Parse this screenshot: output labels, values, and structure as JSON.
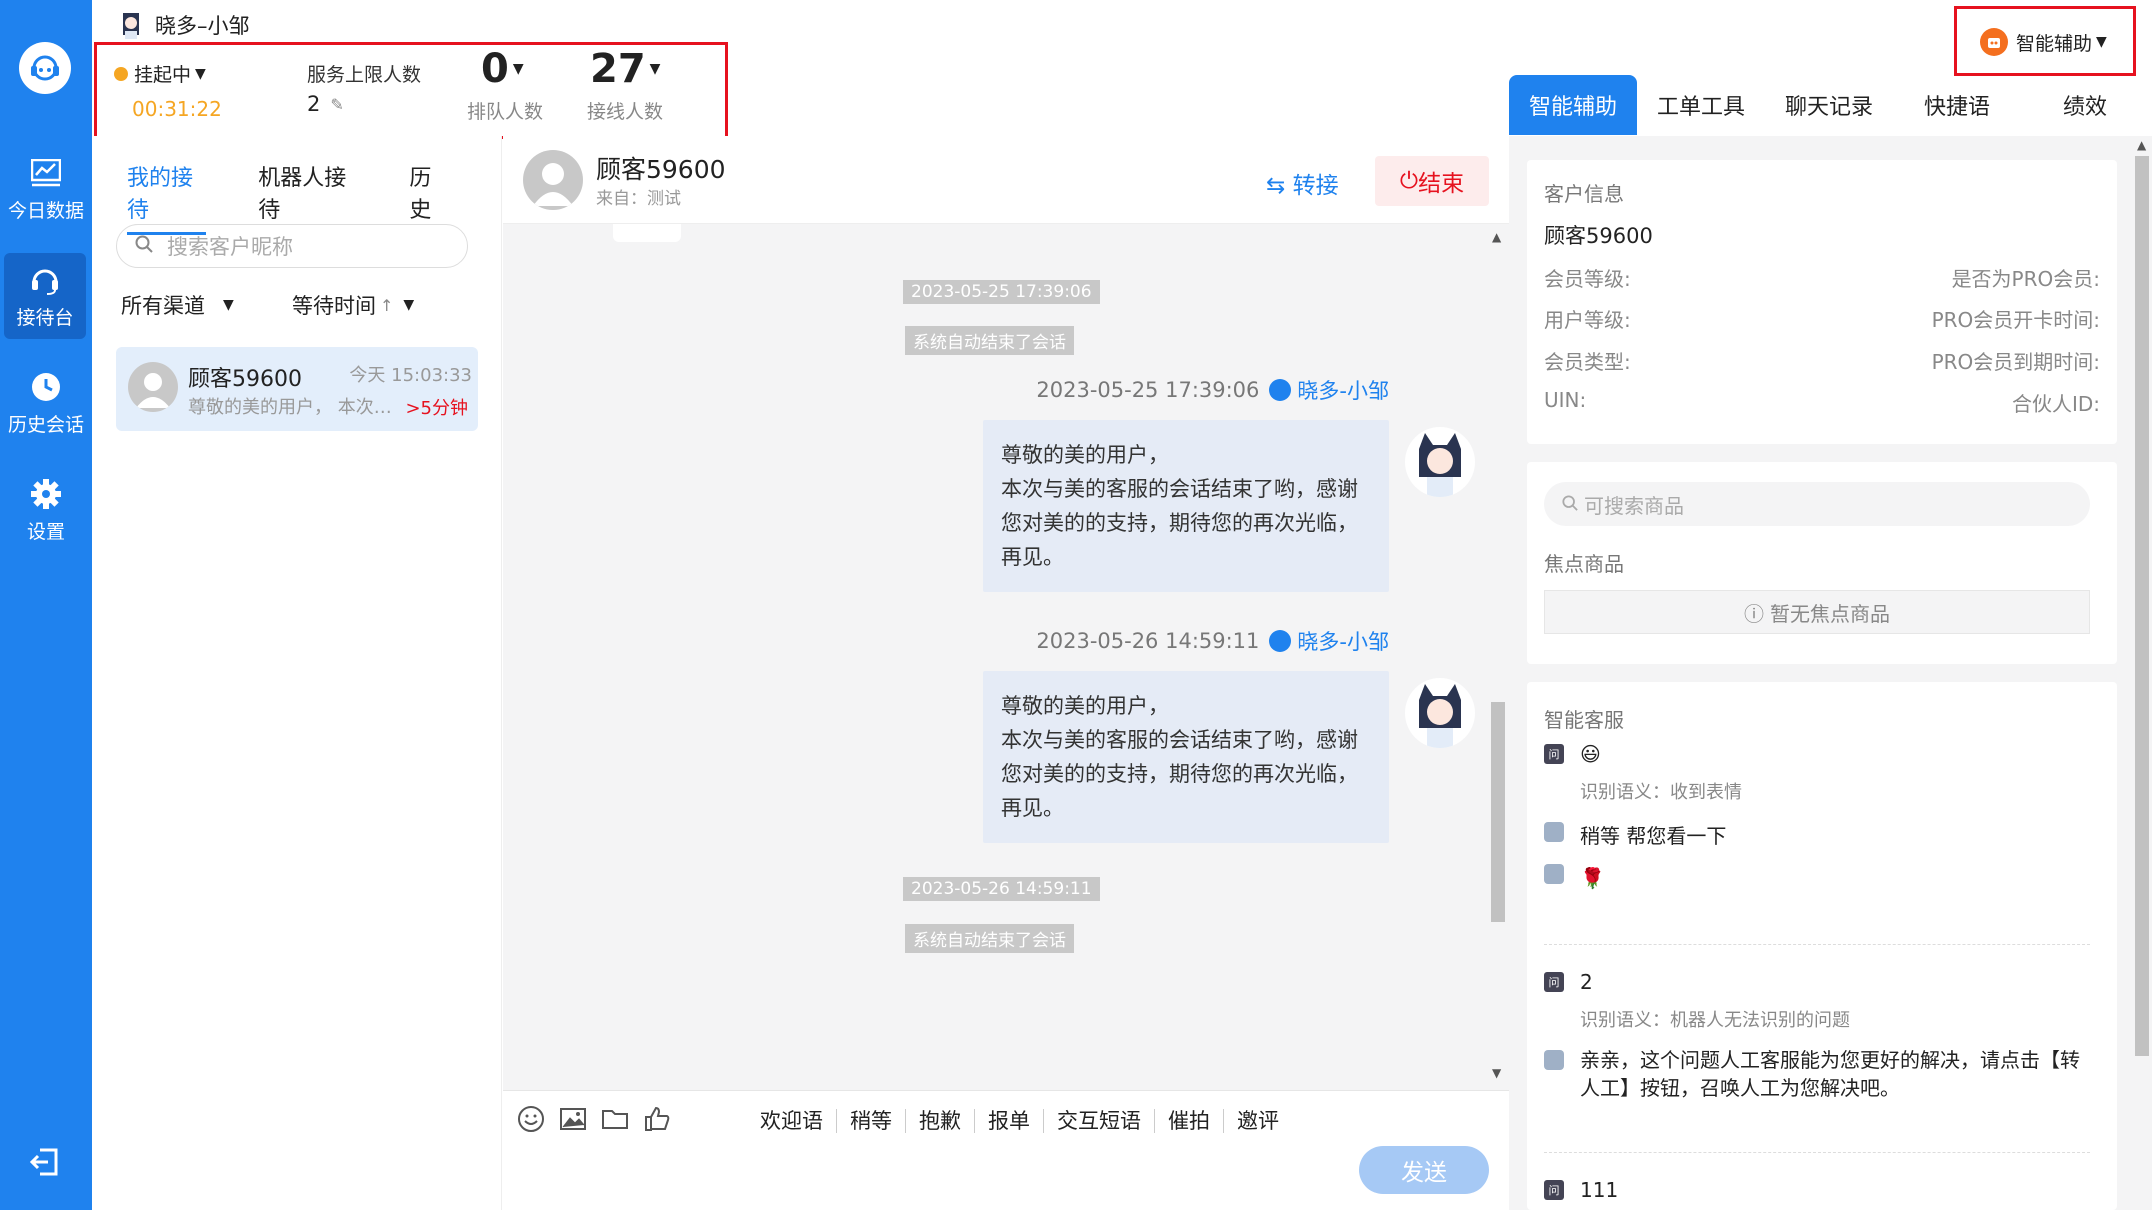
{
  "agent": {
    "name": "晓多–小邹"
  },
  "sidebar": {
    "items": [
      {
        "label": "今日数据",
        "icon": "chart-icon"
      },
      {
        "label": "接待台",
        "icon": "headset-icon"
      },
      {
        "label": "历史会话",
        "icon": "clock-icon"
      },
      {
        "label": "设置",
        "icon": "gear-icon"
      }
    ]
  },
  "status": {
    "state": "挂起中",
    "timer": "00:31:22",
    "service_limit_label": "服务上限人数",
    "service_limit_value": "2",
    "queue_value": "0",
    "queue_label": "排队人数",
    "connected_value": "27",
    "connected_label": "接线人数"
  },
  "top_right": {
    "assist_label": "智能辅助"
  },
  "right_tabs": [
    "智能辅助",
    "工单工具",
    "聊天记录",
    "快捷语",
    "绩效"
  ],
  "left": {
    "tabs": [
      "我的接待",
      "机器人接待",
      "历史"
    ],
    "search_placeholder": "搜索客户昵称",
    "filter_channel": "所有渠道",
    "filter_wait": "等待时间",
    "conversation": {
      "name": "顾客59600",
      "time": "今天 15:03:33",
      "preview": "尊敬的美的用户， 本次与美的客服的会话结束了哟",
      "warn": ">5分钟"
    }
  },
  "chat": {
    "customer": "顾客59600",
    "source": "来自：测试",
    "transfer": "转接",
    "end": "结束",
    "messages": [
      {
        "sys_time": "2023-05-25 17:39:06",
        "sys_text": "系统自动结束了会话"
      },
      {
        "meta_time": "2023-05-25 17:39:06",
        "sender": "晓多-小邹",
        "text": "尊敬的美的用户，\n本次与美的客服的会话结束了哟，感谢您对美的的支持，期待您的再次光临，再见。"
      },
      {
        "meta_time": "2023-05-26 14:59:11",
        "sender": "晓多-小邹",
        "text": "尊敬的美的用户，\n本次与美的客服的会话结束了哟，感谢您对美的的支持，期待您的再次光临，再见。"
      },
      {
        "sys_time": "2023-05-26 14:59:11",
        "sys_text": "系统自动结束了会话"
      }
    ],
    "quick_phrases": [
      "欢迎语",
      "稍等",
      "抱歉",
      "报单",
      "交互短语",
      "催拍",
      "邀评"
    ],
    "send": "发送"
  },
  "customer_info": {
    "title": "客户信息",
    "name": "顾客59600",
    "fields_left": [
      "会员等级:",
      "用户等级:",
      "会员类型:",
      "UIN:"
    ],
    "fields_right": [
      "是否为PRO会员:",
      "PRO会员开卡时间:",
      "PRO会员到期时间:",
      "合伙人ID:"
    ]
  },
  "products": {
    "search_placeholder": "可搜索商品",
    "focus_title": "焦点商品",
    "no_focus": "暂无焦点商品"
  },
  "smart": {
    "title": "智能客服",
    "q1_text": "😃",
    "q1_sem": "识别语义：收到表情",
    "a1": "稍等 帮您看一下",
    "a2": "🌹",
    "q2_text": "2",
    "q2_sem": "识别语义：机器人无法识别的问题",
    "a3": "亲亲，这个问题人工客服能为您更好的解决，请点击【转人工】按钮，召唤人工为您解决吧。",
    "q3_text": "111"
  },
  "colors": {
    "accent": "#1f82ee",
    "warning": "#f5a623",
    "danger": "#e6121f"
  }
}
